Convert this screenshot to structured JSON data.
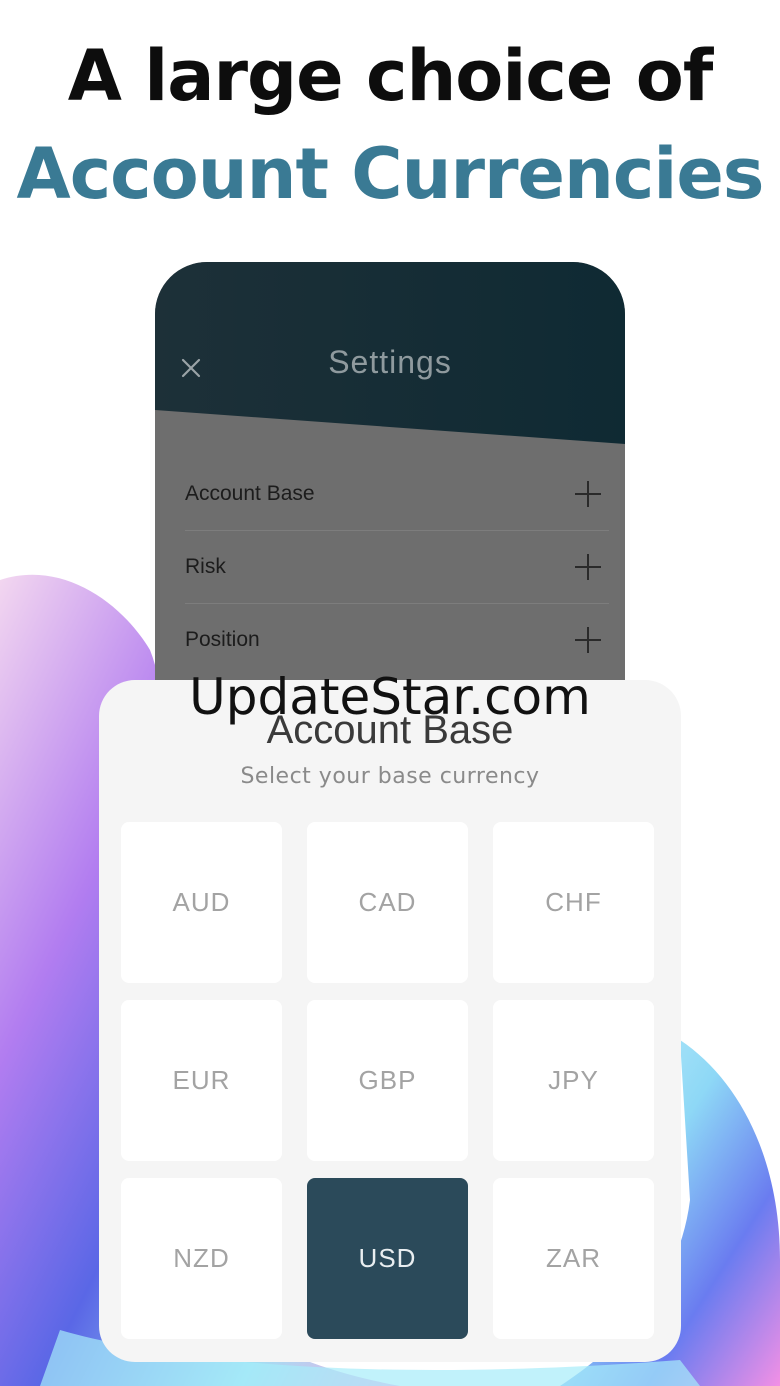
{
  "headline": {
    "line1": "A large choice of",
    "line2": "Account Currencies"
  },
  "colors": {
    "accent": "#3a7a94",
    "header_dark": "#142b34",
    "selected_tile": "#2b4a5a"
  },
  "settings": {
    "title": "Settings",
    "close_icon": "close-icon",
    "items": [
      {
        "label": "Account Base",
        "icon": "plus-icon"
      },
      {
        "label": "Risk",
        "icon": "plus-icon"
      },
      {
        "label": "Position",
        "icon": "plus-icon"
      }
    ]
  },
  "watermark": "UpdateStar.com",
  "account_base": {
    "title": "Account Base",
    "subtitle": "Select your base currency",
    "selected": "USD",
    "currencies": [
      "AUD",
      "CAD",
      "CHF",
      "EUR",
      "GBP",
      "JPY",
      "NZD",
      "USD",
      "ZAR"
    ]
  }
}
